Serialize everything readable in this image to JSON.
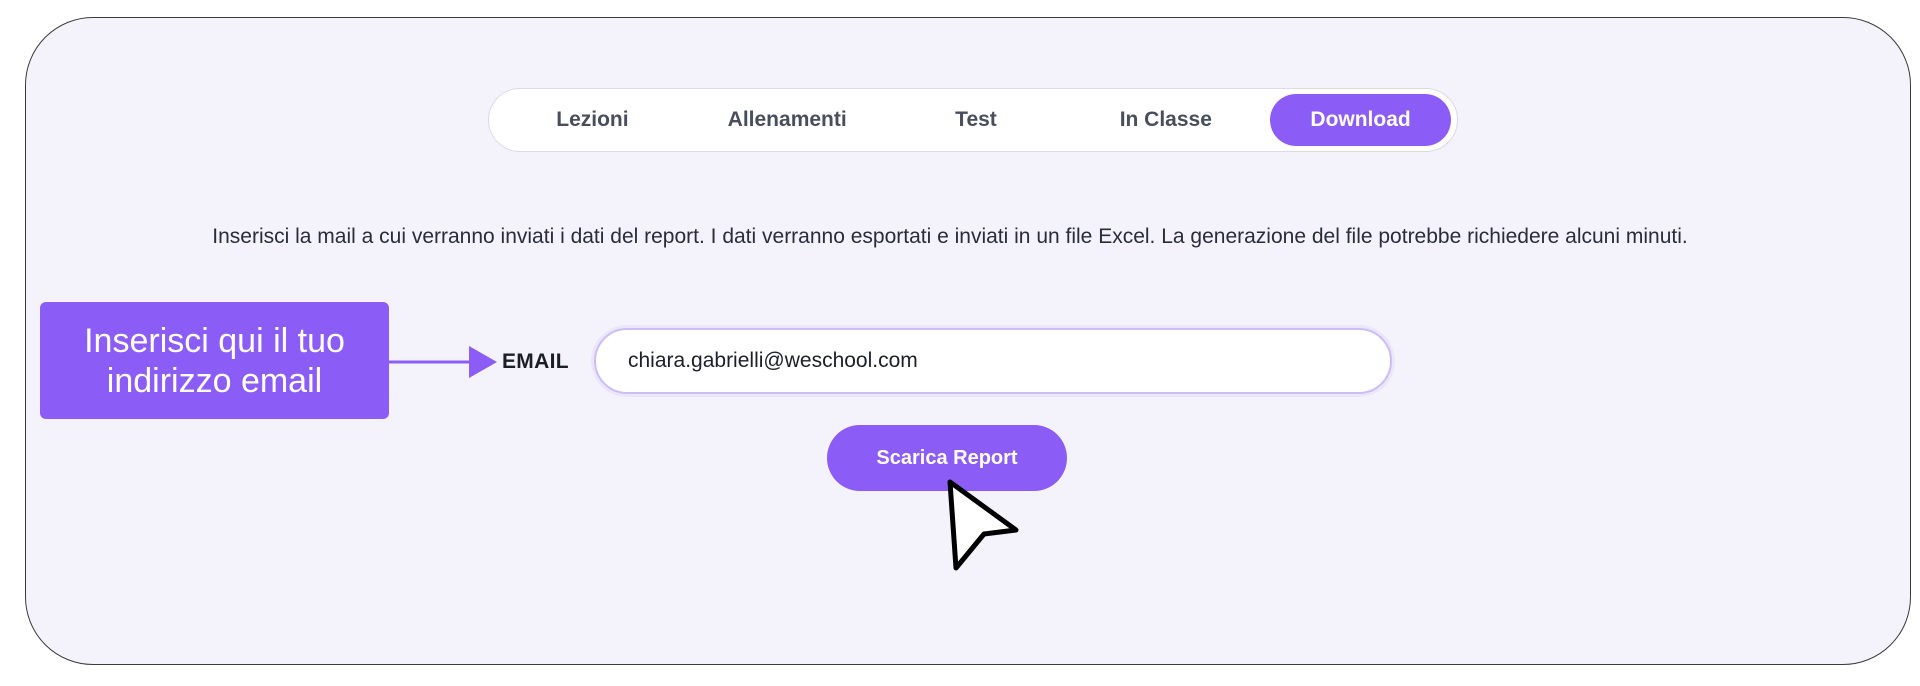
{
  "tabs": [
    {
      "label": "Lezioni",
      "active": false
    },
    {
      "label": "Allenamenti",
      "active": false
    },
    {
      "label": "Test",
      "active": false
    },
    {
      "label": "In Classe",
      "active": false
    },
    {
      "label": "Download",
      "active": true
    }
  ],
  "download": {
    "description": "Inserisci la mail a cui verranno inviati i dati del report. I dati verranno esportati e inviati in un file Excel. La generazione del file potrebbe richiedere alcuni minuti.",
    "email_label": "EMAIL",
    "email_value": "chiara.gabrielli@weschool.com",
    "button_label": "Scarica Report"
  },
  "callout": {
    "text": "Inserisci qui il tuo indirizzo email"
  },
  "colors": {
    "accent": "#8b5cf6",
    "panel_background": "#f4f3fb",
    "text": "#2a2d36"
  }
}
